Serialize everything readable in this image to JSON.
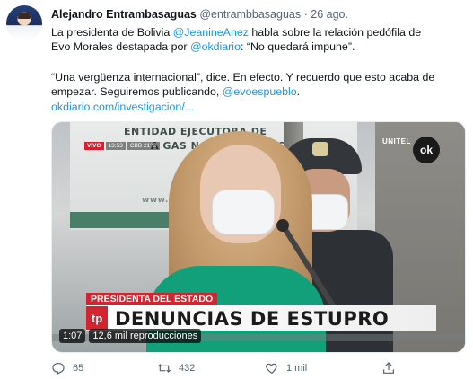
{
  "author": {
    "name": "Alejandro Entrambasaguas",
    "handle": "@entrambbasaguas",
    "separator": "·",
    "date": "26 ago."
  },
  "text": {
    "line1_a": "La presidenta de Bolivia ",
    "line1_mention": "@JeanineAnez",
    "line1_b": " habla sobre la relación pedófila de",
    "line2_a": "Evo Morales destapada por ",
    "line2_mention": "@okdiario",
    "line2_b": ": “No quedará impune”.",
    "line3": "“Una vergüenza internacional”, dice. En efecto. Y recuerdo que esto acaba de",
    "line4_a": "empezar. Seguiremos publicando, ",
    "line4_mention": "@evoespueblo",
    "line4_b": ".",
    "link": "okdiario.com/investigacion/..."
  },
  "video": {
    "banner_line1": "ENTIDAD EJECUTORA DE",
    "banner_line2": "A GAS NATURAL VEHICULAR",
    "banner_line3": "www.eecgnv.gob",
    "live_label": "VIVO",
    "live_time": "13:53",
    "live_temp": "CBB 21°C",
    "channel": "UNITEL",
    "logo": "ok",
    "lower_third_label": "PRESIDENTA DEL ESTADO",
    "lower_third_logo": "tp",
    "headline": "DENUNCIAS DE ESTUPRO",
    "duration": "1:07",
    "views": "12,6 mil reproducciones"
  },
  "actions": {
    "replies": "65",
    "retweets": "432",
    "likes": "1 mil"
  }
}
